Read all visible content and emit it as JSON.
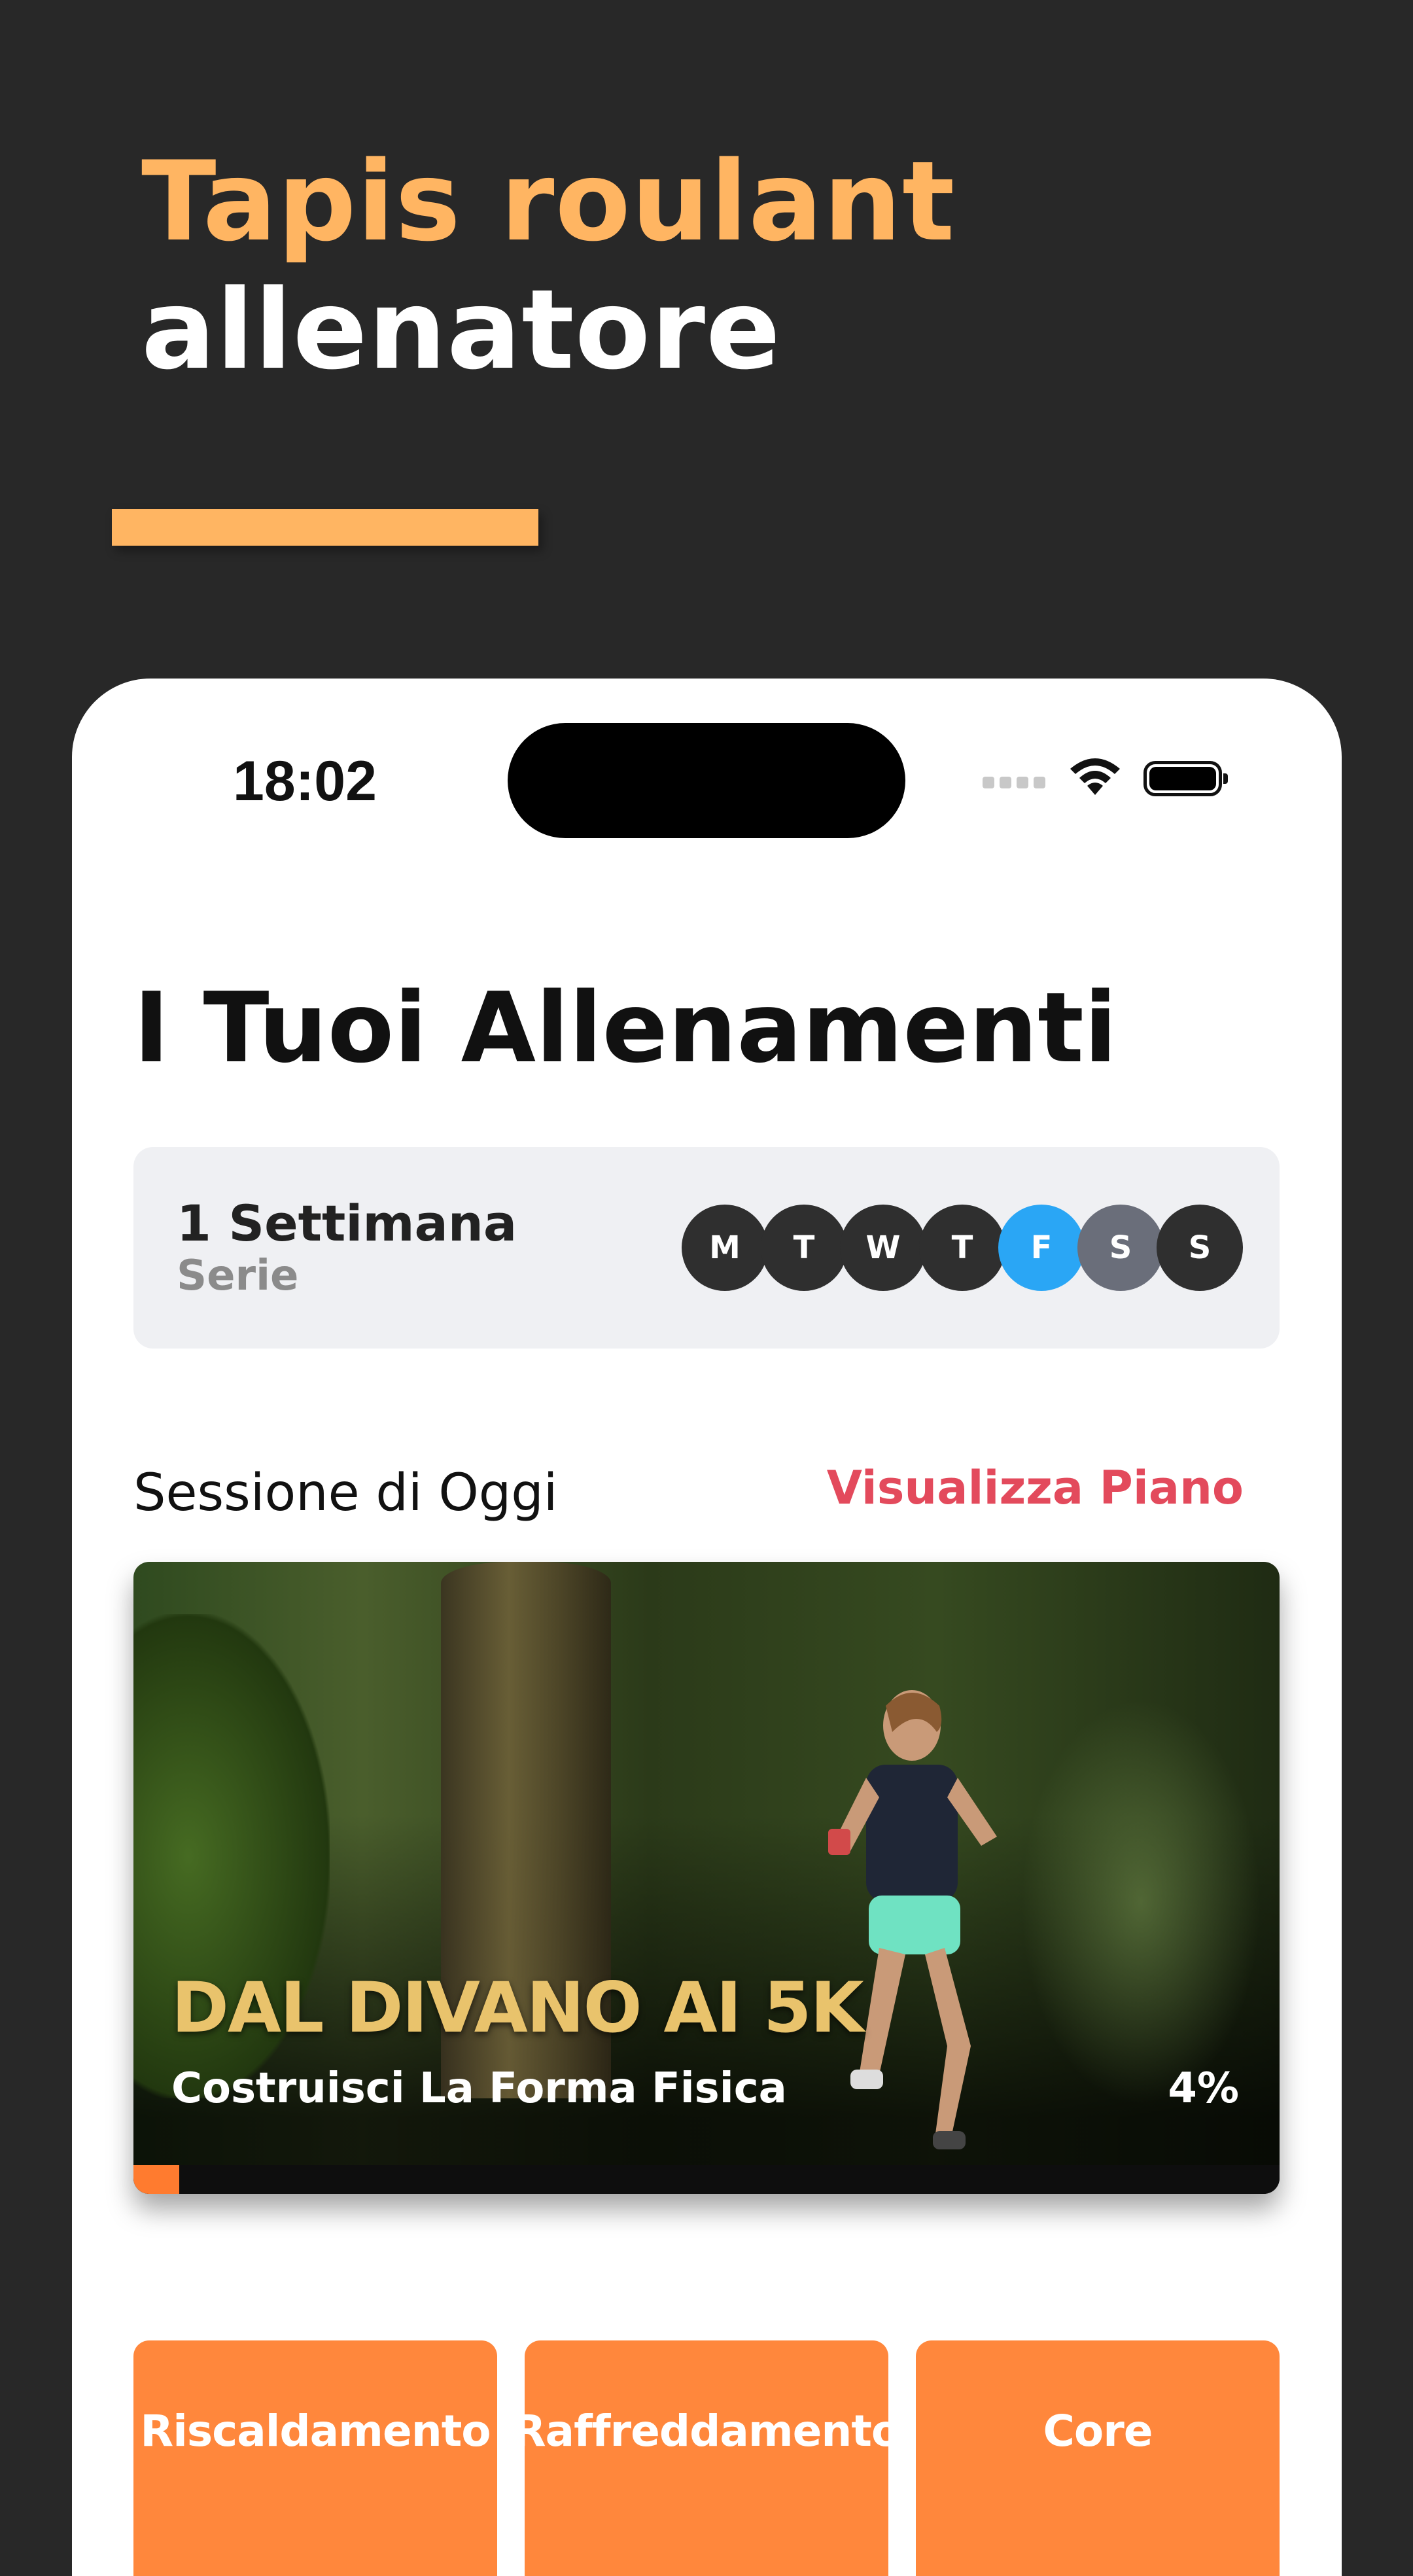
{
  "headline": {
    "line1": "Tapis roulant",
    "line2": "allenatore"
  },
  "colors": {
    "accent": "#ffb562",
    "background": "#282828",
    "orange": "#ff873c",
    "link": "#e34a5c",
    "today": "#2aa6f5",
    "missed": "#6a6e7a"
  },
  "status_bar": {
    "time": "18:02",
    "icons": [
      "cellular-icon",
      "wifi-icon",
      "battery-icon"
    ]
  },
  "page_title": "I Tuoi Allenamenti",
  "streak": {
    "value": "1 Settimana",
    "label": "Serie",
    "days": [
      {
        "letter": "M",
        "state": "default"
      },
      {
        "letter": "T",
        "state": "default"
      },
      {
        "letter": "W",
        "state": "default"
      },
      {
        "letter": "T",
        "state": "default"
      },
      {
        "letter": "F",
        "state": "today"
      },
      {
        "letter": "S",
        "state": "missed"
      },
      {
        "letter": "S",
        "state": "default"
      }
    ]
  },
  "today_session": {
    "label": "Sessione di Oggi",
    "link": "Visualizza Piano",
    "card": {
      "title": "DAL DIVANO AI 5K",
      "subtitle": "Costruisci La Forma Fisica",
      "progress_label": "4%",
      "progress": 0.04
    }
  },
  "categories": [
    "Riscaldamento",
    "Raffreddamento",
    "Core"
  ]
}
